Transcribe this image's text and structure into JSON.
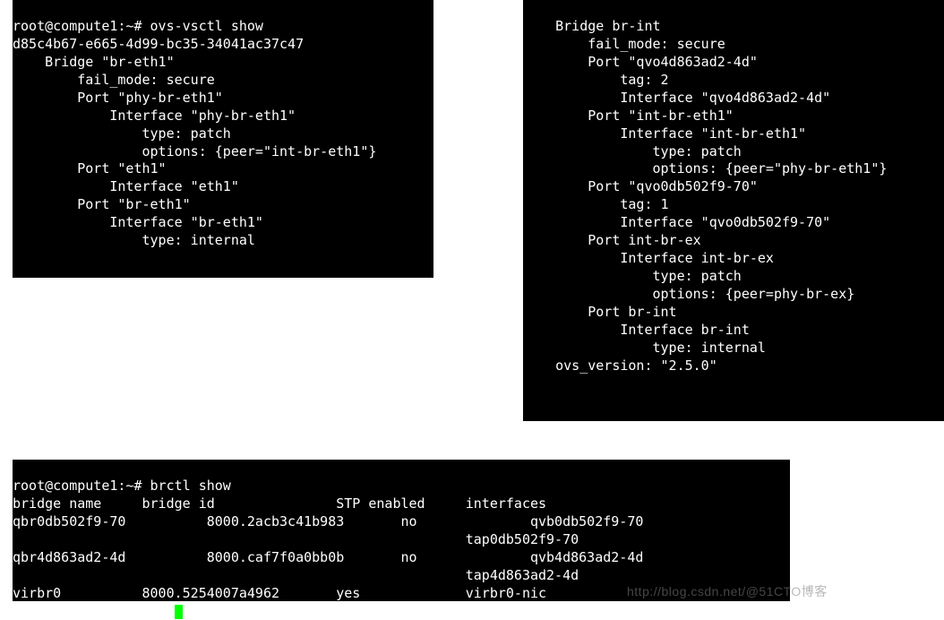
{
  "terminal_left": {
    "prompt": "root@compute1:~# ",
    "command": "ovs-vsctl show",
    "lines": [
      "d85c4b67-e665-4d99-bc35-34041ac37c47",
      "    Bridge \"br-eth1\"",
      "        fail_mode: secure",
      "        Port \"phy-br-eth1\"",
      "            Interface \"phy-br-eth1\"",
      "                type: patch",
      "                options: {peer=\"int-br-eth1\"}",
      "        Port \"eth1\"",
      "            Interface \"eth1\"",
      "        Port \"br-eth1\"",
      "            Interface \"br-eth1\"",
      "                type: internal"
    ]
  },
  "terminal_right": {
    "lines": [
      "    Bridge br-int",
      "        fail_mode: secure",
      "        Port \"qvo4d863ad2-4d\"",
      "            tag: 2",
      "            Interface \"qvo4d863ad2-4d\"",
      "        Port \"int-br-eth1\"",
      "            Interface \"int-br-eth1\"",
      "                type: patch",
      "                options: {peer=\"phy-br-eth1\"}",
      "        Port \"qvo0db502f9-70\"",
      "            tag: 1",
      "            Interface \"qvo0db502f9-70\"",
      "        Port int-br-ex",
      "            Interface int-br-ex",
      "                type: patch",
      "                options: {peer=phy-br-ex}",
      "        Port br-int",
      "            Interface br-int",
      "                type: internal",
      "    ovs_version: \"2.5.0\""
    ]
  },
  "terminal_bottom": {
    "prompt": "root@compute1:~# ",
    "command": "brctl show",
    "header": "bridge name     bridge id               STP enabled     interfaces",
    "rows": [
      "qbr0db502f9-70          8000.2acb3c41b983       no              qvb0db502f9-70",
      "                                                        tap0db502f9-70",
      "qbr4d863ad2-4d          8000.caf7f0a0bb0b       no              qvb4d863ad2-4d",
      "                                                        tap4d863ad2-4d",
      "virbr0          8000.5254007a4962       yes             virbr0-nic"
    ]
  },
  "watermark": "http://blog.csdn.net/@51CTO博客"
}
